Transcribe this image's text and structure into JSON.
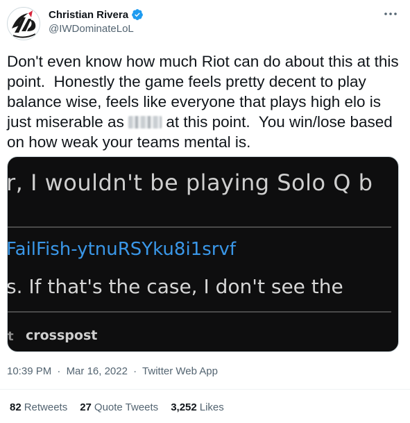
{
  "author": {
    "display_name": "Christian Rivera",
    "handle": "@IWDominateLoL",
    "verified": true,
    "avatar_icon": "iwd-logo-avatar"
  },
  "tweet": {
    "text_part1": "Don't even know how much Riot can do about this at this point.  Honestly the game feels pretty decent to play balance wise, feels like everyone that plays high elo is just miserable as ",
    "text_part2": " at this point.  You win/lose based on how weak your teams mental is."
  },
  "media": {
    "line1": "r, I wouldn't be playing Solo Q b",
    "link": "FailFish-ytnuRSYku8i1srvf",
    "line3": "s. If that's the case, I don't see the",
    "bullet": "t",
    "crosspost": "crosspost"
  },
  "meta": {
    "time": "10:39 PM",
    "separator": "·",
    "date": "Mar 16, 2022",
    "app": "Twitter Web App"
  },
  "stats": {
    "retweets_count": "82",
    "retweets_label": "Retweets",
    "quotes_count": "27",
    "quotes_label": "Quote Tweets",
    "likes_count": "3,252",
    "likes_label": "Likes"
  },
  "colors": {
    "accent": "#1d9bf0",
    "text": "#0f1419",
    "secondary": "#536471",
    "media_bg": "#0e0e0f",
    "media_link": "#3a97e8"
  }
}
